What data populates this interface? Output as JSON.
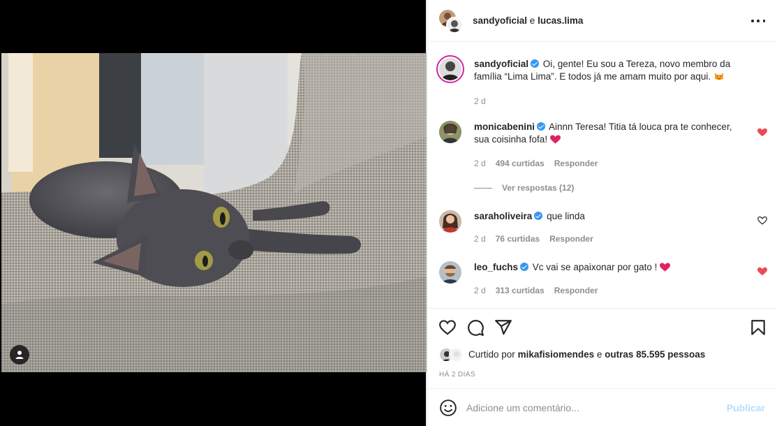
{
  "colors": {
    "accent": "#3897f0",
    "heart": "#ed4956",
    "muted": "#8e8e8e",
    "post_disabled": "#b2dffc"
  },
  "header": {
    "user1": "sandyoficial",
    "sep": "e",
    "user2": "lucas.lima",
    "more_icon": "more-horizontal-icon"
  },
  "caption": {
    "username": "sandyoficial",
    "text": "Oi, gente! Eu sou a Tereza, novo membro da família “Lima Lima”. E todos já me amam muito por aqui.",
    "emoji": "smiling-cat-heart-eyes-icon",
    "time": "2 d"
  },
  "comments": [
    {
      "username": "monicabenini",
      "text": "Ainnn Teresa! Titia tá louca pra te conhecer, sua coisinha fofa!",
      "emoji": "red-heart-icon",
      "time": "2 d",
      "likes": "494 curtidas",
      "reply": "Responder",
      "liked": true
    },
    {
      "username": "saraholiveira",
      "text": "que linda",
      "time": "2 d",
      "likes": "76 curtidas",
      "reply": "Responder",
      "liked": false
    },
    {
      "username": "leo_fuchs",
      "text": "Vc vai se apaixonar por gato !",
      "emoji": "red-heart-icon",
      "time": "2 d",
      "likes": "313 curtidas",
      "reply": "Responder",
      "liked": true
    }
  ],
  "view_replies": "Ver respostas (12)",
  "likes": {
    "prefix": "Curtido por",
    "user": "mikafisiomendes",
    "middle": "e",
    "others": "outras 85.595 pessoas"
  },
  "timestamp": "HÁ 2 DIAS",
  "comment_box": {
    "placeholder": "Adicione um comentário...",
    "post": "Publicar"
  }
}
